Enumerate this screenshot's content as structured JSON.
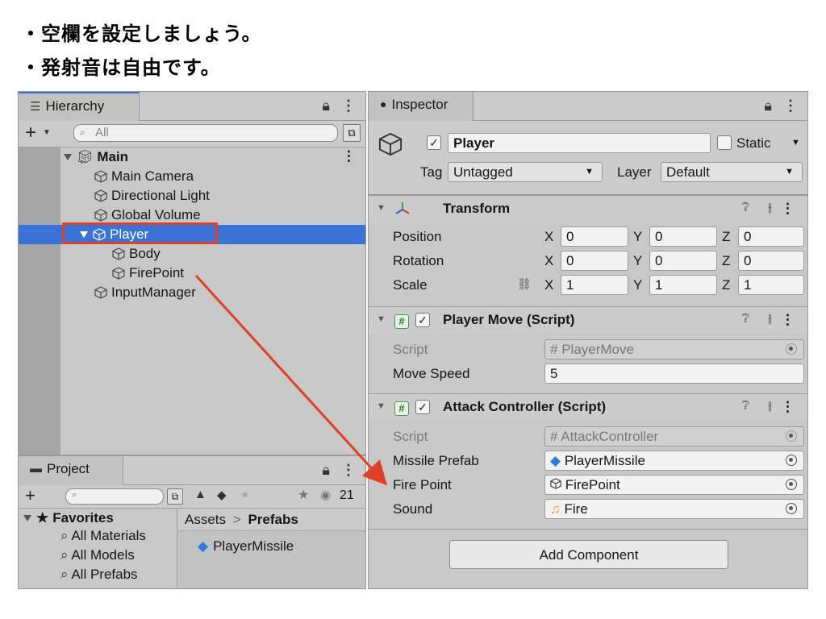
{
  "notes": [
    "・空欄を設定しましょう。",
    "・発射音は自由です。"
  ],
  "hierarchy": {
    "tab": "Hierarchy",
    "search_placeholder": "All",
    "items": [
      {
        "label": "Main",
        "depth": 0,
        "expanded": true
      },
      {
        "label": "Main Camera",
        "depth": 1
      },
      {
        "label": "Directional Light",
        "depth": 1
      },
      {
        "label": "Global Volume",
        "depth": 1
      },
      {
        "label": "Player",
        "depth": 1,
        "expanded": true,
        "selected": true
      },
      {
        "label": "Body",
        "depth": 2
      },
      {
        "label": "FirePoint",
        "depth": 2
      },
      {
        "label": "InputManager",
        "depth": 1
      }
    ]
  },
  "project": {
    "tab": "Project",
    "hidden_count": "21",
    "favorites": {
      "label": "Favorites",
      "items": [
        "All Materials",
        "All Models",
        "All Prefabs"
      ]
    },
    "breadcrumb": {
      "root": "Assets",
      "sep": ">",
      "current": "Prefabs"
    },
    "assets": [
      "PlayerMissile"
    ]
  },
  "inspector": {
    "tab": "Inspector",
    "object_name": "Player",
    "static_label": "Static",
    "tag_label": "Tag",
    "tag_value": "Untagged",
    "layer_label": "Layer",
    "layer_value": "Default",
    "transform": {
      "title": "Transform",
      "rows": [
        {
          "label": "Position",
          "x": "0",
          "y": "0",
          "z": "0"
        },
        {
          "label": "Rotation",
          "x": "0",
          "y": "0",
          "z": "0"
        },
        {
          "label": "Scale",
          "x": "1",
          "y": "1",
          "z": "1"
        }
      ],
      "axes": [
        "X",
        "Y",
        "Z"
      ]
    },
    "player_move": {
      "title": "Player Move (Script)",
      "script_label": "Script",
      "script_value": "PlayerMove",
      "speed_label": "Move Speed",
      "speed_value": "5"
    },
    "attack": {
      "title": "Attack Controller (Script)",
      "script_label": "Script",
      "script_value": "AttackController",
      "prefab_label": "Missile Prefab",
      "prefab_value": "PlayerMissile",
      "fire_label": "Fire Point",
      "fire_value": "FirePoint",
      "sound_label": "Sound",
      "sound_value": "Fire"
    },
    "add_component": "Add Component"
  },
  "colors": {
    "selection": "#3a72d8",
    "annotation": "#e0402a",
    "tab_accent": "#3a72d8"
  }
}
